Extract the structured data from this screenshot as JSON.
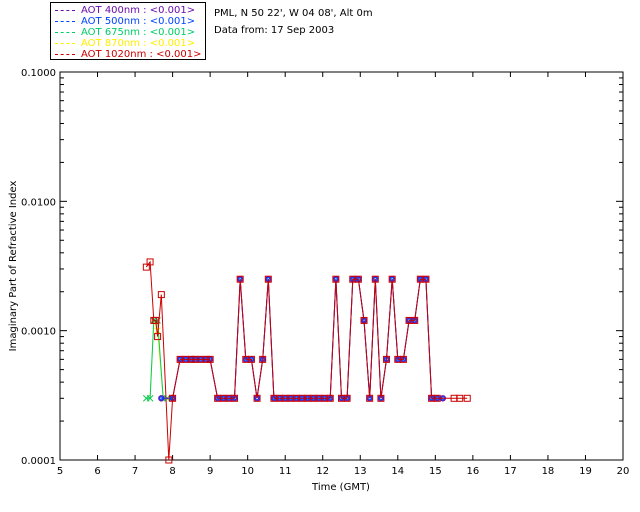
{
  "info": {
    "site": "PML, N 50 22', W 04 08', Alt 0m",
    "date": "Data from: 17 Sep 2003"
  },
  "legend": [
    {
      "label": "AOT  400nm : <0.001>",
      "color": "#6a0dad"
    },
    {
      "label": "AOT  500nm : <0.001>",
      "color": "#0044ff"
    },
    {
      "label": "AOT  675nm : <0.001>",
      "color": "#00cc66"
    },
    {
      "label": "AOT  870nm : <0.001>",
      "color": "#ffee00"
    },
    {
      "label": "AOT 1020nm : <0.001>",
      "color": "#cc0000"
    }
  ],
  "chart_data": {
    "type": "line",
    "xlabel": "Time (GMT)",
    "ylabel": "Imaginary Part of Refractive Index",
    "xlim": [
      5,
      20
    ],
    "ylim": [
      0.0001,
      0.1
    ],
    "yscale": "log",
    "xticks": [
      5,
      6,
      7,
      8,
      9,
      10,
      11,
      12,
      13,
      14,
      15,
      16,
      17,
      18,
      19,
      20
    ],
    "yticks": [
      0.0001,
      0.001,
      0.01,
      0.1
    ],
    "ytick_labels": [
      "0.0001",
      "0.0010",
      "0.0100",
      "0.1000"
    ],
    "series": [
      {
        "name": "AOT 400nm",
        "color": "#6a0dad",
        "marker": "circle",
        "x": [
          7.7,
          8.0,
          8.2,
          8.35,
          8.5,
          8.6,
          8.75,
          8.9,
          9.0,
          9.2,
          9.35,
          9.5,
          9.65,
          9.8,
          9.95,
          10.1,
          10.25,
          10.4,
          10.55,
          10.7,
          10.85,
          11.0,
          11.15,
          11.3,
          11.45,
          11.6,
          11.75,
          11.9,
          12.05,
          12.2,
          12.35,
          12.5,
          12.65,
          12.8,
          12.95,
          13.1,
          13.25,
          13.4,
          13.55,
          13.7,
          13.85,
          14.0,
          14.15,
          14.3,
          14.45,
          14.6,
          14.75,
          14.9,
          15.05,
          15.2
        ],
        "y": [
          0.0003,
          0.0003,
          0.0006,
          0.0006,
          0.0006,
          0.0006,
          0.0006,
          0.0006,
          0.0006,
          0.0003,
          0.0003,
          0.0003,
          0.0003,
          0.0025,
          0.0006,
          0.0006,
          0.0003,
          0.0006,
          0.0025,
          0.0003,
          0.0003,
          0.0003,
          0.0003,
          0.0003,
          0.0003,
          0.0003,
          0.0003,
          0.0003,
          0.0003,
          0.0003,
          0.0025,
          0.0003,
          0.0003,
          0.0025,
          0.0025,
          0.0012,
          0.0003,
          0.0025,
          0.0003,
          0.0006,
          0.0025,
          0.0006,
          0.0006,
          0.0012,
          0.0012,
          0.0025,
          0.0025,
          0.0003,
          0.0003,
          0.0003
        ]
      },
      {
        "name": "AOT 500nm",
        "color": "#0044ff",
        "marker": "circle",
        "x": [
          7.7,
          8.0,
          8.2,
          8.35,
          8.5,
          8.6,
          8.75,
          8.9,
          9.0,
          9.2,
          9.35,
          9.5,
          9.65,
          9.8,
          9.95,
          10.1,
          10.25,
          10.4,
          10.55,
          10.7,
          10.85,
          11.0,
          11.15,
          11.3,
          11.45,
          11.6,
          11.75,
          11.9,
          12.05,
          12.2,
          12.35,
          12.5,
          12.65,
          12.8,
          12.95,
          13.1,
          13.25,
          13.4,
          13.55,
          13.7,
          13.85,
          14.0,
          14.15,
          14.3,
          14.45,
          14.6,
          14.75,
          14.9,
          15.05,
          15.2
        ],
        "y": [
          0.0003,
          0.0003,
          0.0006,
          0.0006,
          0.0006,
          0.0006,
          0.0006,
          0.0006,
          0.0006,
          0.0003,
          0.0003,
          0.0003,
          0.0003,
          0.0025,
          0.0006,
          0.0006,
          0.0003,
          0.0006,
          0.0025,
          0.0003,
          0.0003,
          0.0003,
          0.0003,
          0.0003,
          0.0003,
          0.0003,
          0.0003,
          0.0003,
          0.0003,
          0.0003,
          0.0025,
          0.0003,
          0.0003,
          0.0025,
          0.0025,
          0.0012,
          0.0003,
          0.0025,
          0.0003,
          0.0006,
          0.0025,
          0.0006,
          0.0006,
          0.0012,
          0.0012,
          0.0025,
          0.0025,
          0.0003,
          0.0003,
          0.0003
        ]
      },
      {
        "name": "AOT 675nm",
        "color": "#00cc66",
        "marker": "x",
        "x": [
          7.3,
          7.4,
          7.5,
          7.6,
          7.75,
          7.85
        ],
        "y": [
          0.0003,
          0.0003,
          0.0012,
          0.0012,
          0.0003,
          0.0003
        ]
      },
      {
        "name": "AOT 870nm",
        "color": "#ffee00",
        "marker": "x",
        "x": [
          7.3,
          7.4,
          7.5,
          7.6,
          7.75,
          7.85,
          8.0
        ],
        "y": [
          0.0003,
          0.0003,
          0.0012,
          0.001,
          0.0003,
          0.0003,
          0.0003
        ]
      },
      {
        "name": "AOT 1020nm",
        "color": "#cc0000",
        "marker": "square",
        "x": [
          7.3,
          7.4,
          7.5,
          7.55,
          7.6,
          7.7,
          7.9,
          8.0,
          8.2,
          8.35,
          8.5,
          8.6,
          8.75,
          8.9,
          9.0,
          9.2,
          9.35,
          9.5,
          9.65,
          9.8,
          9.95,
          10.1,
          10.25,
          10.4,
          10.55,
          10.7,
          10.85,
          11.0,
          11.15,
          11.3,
          11.45,
          11.6,
          11.75,
          11.9,
          12.05,
          12.2,
          12.35,
          12.5,
          12.65,
          12.8,
          12.95,
          13.1,
          13.25,
          13.4,
          13.55,
          13.7,
          13.85,
          14.0,
          14.15,
          14.3,
          14.45,
          14.6,
          14.75,
          14.9,
          15.05,
          15.5,
          15.65,
          15.85
        ],
        "y": [
          0.0031,
          0.0034,
          0.0012,
          0.0012,
          0.0009,
          0.0019,
          0.0001,
          0.0003,
          0.0006,
          0.0006,
          0.0006,
          0.0006,
          0.0006,
          0.0006,
          0.0006,
          0.0003,
          0.0003,
          0.0003,
          0.0003,
          0.0025,
          0.0006,
          0.0006,
          0.0003,
          0.0006,
          0.0025,
          0.0003,
          0.0003,
          0.0003,
          0.0003,
          0.0003,
          0.0003,
          0.0003,
          0.0003,
          0.0003,
          0.0003,
          0.0003,
          0.0025,
          0.0003,
          0.0003,
          0.0025,
          0.0025,
          0.0012,
          0.0003,
          0.0025,
          0.0003,
          0.0006,
          0.0025,
          0.0006,
          0.0006,
          0.0012,
          0.0012,
          0.0025,
          0.0025,
          0.0003,
          0.0003,
          0.0003,
          0.0003,
          0.0003
        ]
      }
    ]
  }
}
